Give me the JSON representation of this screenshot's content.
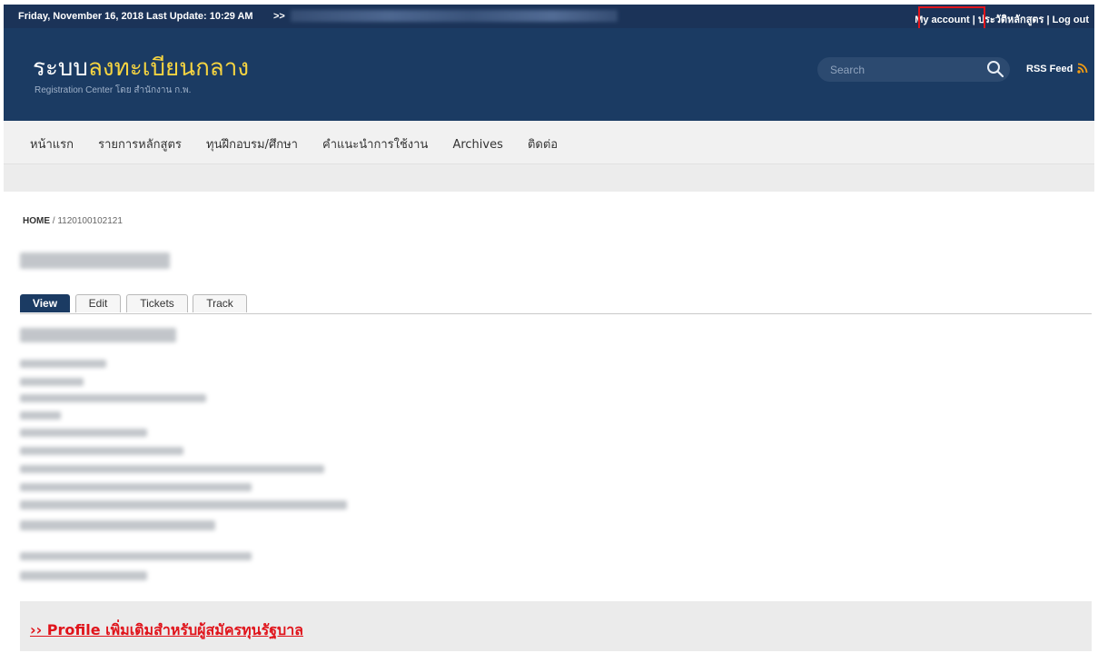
{
  "topbar": {
    "date_text": "Friday, November 16, 2018 Last Update: 10:29 AM",
    "arrows": ">>",
    "my_account": "My account",
    "sep1": " | ",
    "course_history": "ประวัติหลักสูตร",
    "sep2": " | ",
    "logout": "Log out"
  },
  "header": {
    "logo_prefix": "ระบบ",
    "logo_accent": "ลงทะเบียนกลาง",
    "logo_sub": "Registration Center โดย สำนักงาน ก.พ.",
    "search_placeholder": "Search",
    "rss_label": "RSS Feed"
  },
  "nav": {
    "items": [
      "หน้าแรก",
      "รายการหลักสูตร",
      "ทุนฝึกอบรม/ศึกษา",
      "คำแนะนำการใช้งาน",
      "Archives",
      "ติดต่อ"
    ]
  },
  "breadcrumb": {
    "home": "HOME",
    "separator": " / ",
    "current": "1120100102121"
  },
  "tabs": [
    "View",
    "Edit",
    "Tickets",
    "Track"
  ],
  "profile_link": "›› Profile เพิ่มเติมสำหรับผู้สมัครทุนรัฐบาล",
  "colors": {
    "header_bg": "#1b3b63",
    "topbar_bg": "#1b3358",
    "logo_accent": "#f5d441",
    "link_red": "#e0141b"
  }
}
